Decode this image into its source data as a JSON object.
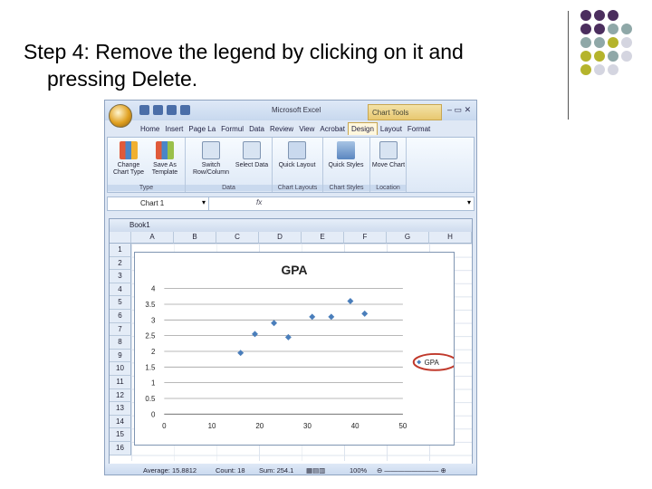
{
  "slide": {
    "title_line1": "Step 4: Remove the legend by clicking on it and",
    "title_line2": "pressing Delete.",
    "accent_colors": [
      "#4b2e5e",
      "#8fa8a8",
      "#b5b42c",
      "#d4d5e0"
    ]
  },
  "excel": {
    "app_title": "Microsoft Excel",
    "chart_tools": "Chart Tools",
    "tabs": [
      "Home",
      "Insert",
      "Page La",
      "Formul",
      "Data",
      "Review",
      "View",
      "Acrobat",
      "Design",
      "Layout",
      "Format"
    ],
    "active_tab": "Design",
    "ribbon_groups": [
      {
        "label": "Type",
        "buttons": [
          "Change Chart Type",
          "Save As Template"
        ]
      },
      {
        "label": "Data",
        "buttons": [
          "Switch Row/Column",
          "Select Data"
        ]
      },
      {
        "label": "Chart Layouts",
        "buttons": [
          "Quick Layout"
        ]
      },
      {
        "label": "Chart Styles",
        "buttons": [
          "Quick Styles"
        ]
      },
      {
        "label": "Location",
        "buttons": [
          "Move Chart"
        ]
      }
    ],
    "name_box": "Chart 1",
    "fx": "fx",
    "workbook_title": "Book1",
    "columns": [
      "A",
      "B",
      "C",
      "D",
      "E",
      "F",
      "G",
      "H"
    ],
    "rows": [
      "1",
      "2",
      "3",
      "4",
      "5",
      "6",
      "7",
      "8",
      "9",
      "10",
      "11",
      "12",
      "13",
      "14",
      "15",
      "16"
    ],
    "status": {
      "average": "Average: 15.8812",
      "count": "Count: 18",
      "sum": "Sum: 254.1",
      "zoom": "100%"
    }
  },
  "chart_data": {
    "type": "scatter",
    "title": "GPA",
    "xlim": [
      0,
      50
    ],
    "ylim": [
      0,
      4
    ],
    "x_ticks": [
      "0",
      "10",
      "20",
      "30",
      "40",
      "50"
    ],
    "y_ticks": [
      "0",
      "0.5",
      "1",
      "1.5",
      "2",
      "2.5",
      "3",
      "3.5",
      "4"
    ],
    "grid": true,
    "legend": "right",
    "series": [
      {
        "name": "GPA",
        "color": "#4a7ebb",
        "x": [
          16,
          19,
          23,
          26,
          31,
          35,
          39,
          42
        ],
        "y": [
          1.95,
          2.55,
          2.9,
          2.45,
          3.1,
          3.1,
          3.6,
          3.2
        ]
      }
    ],
    "highlight_color": "#c0392b"
  }
}
